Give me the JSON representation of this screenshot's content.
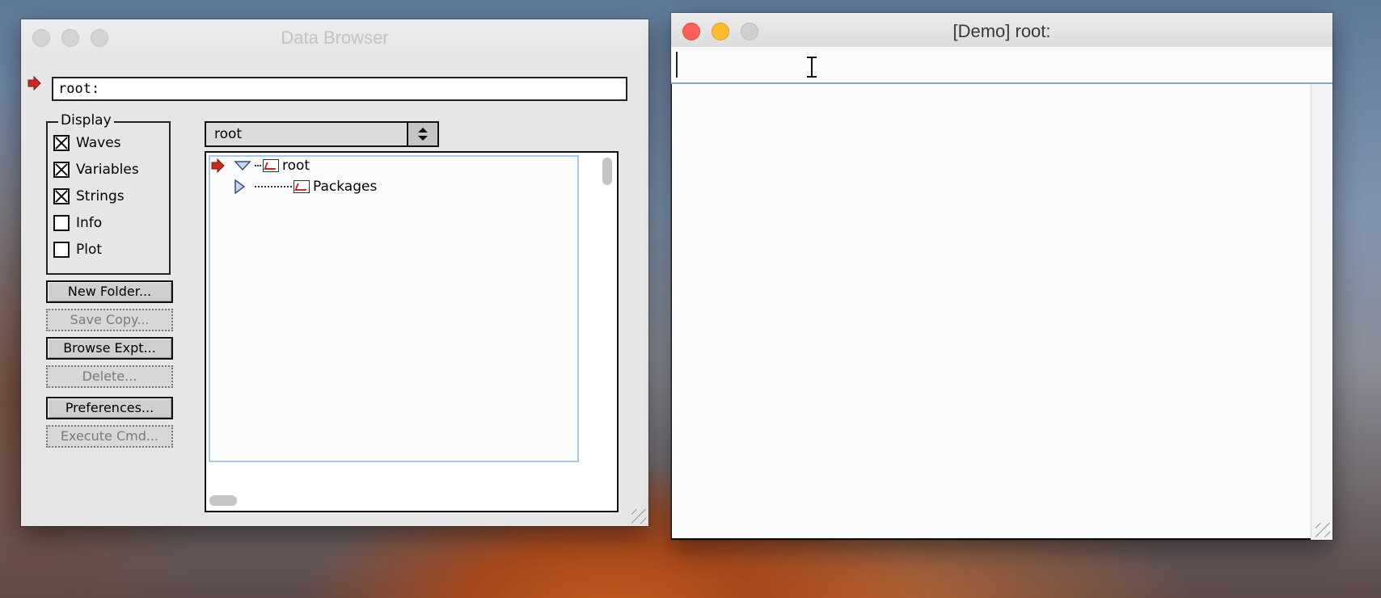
{
  "data_browser": {
    "title": "Data Browser",
    "path_value": "root:",
    "display_group": {
      "label": "Display",
      "items": [
        {
          "label": "Waves",
          "checked": true
        },
        {
          "label": "Variables",
          "checked": true
        },
        {
          "label": "Strings",
          "checked": true
        },
        {
          "label": "Info",
          "checked": false
        },
        {
          "label": "Plot",
          "checked": false
        }
      ]
    },
    "buttons": {
      "new_folder": "New Folder...",
      "save_copy": "Save Copy...",
      "browse_expt": "Browse Expt...",
      "delete": "Delete...",
      "preferences": "Preferences...",
      "execute_cmd": "Execute Cmd..."
    },
    "folder_popup": "root",
    "tree": [
      {
        "label": "root",
        "expanded": true,
        "current": true
      },
      {
        "label": "Packages",
        "expanded": false,
        "current": false
      }
    ]
  },
  "command_window": {
    "title": "[Demo] root:",
    "input_value": ""
  },
  "colors": {
    "current_arrow": "#c8291b",
    "selection_border": "#a8c8ea",
    "close": "#fc5f57",
    "minimize": "#fdbc2e"
  }
}
